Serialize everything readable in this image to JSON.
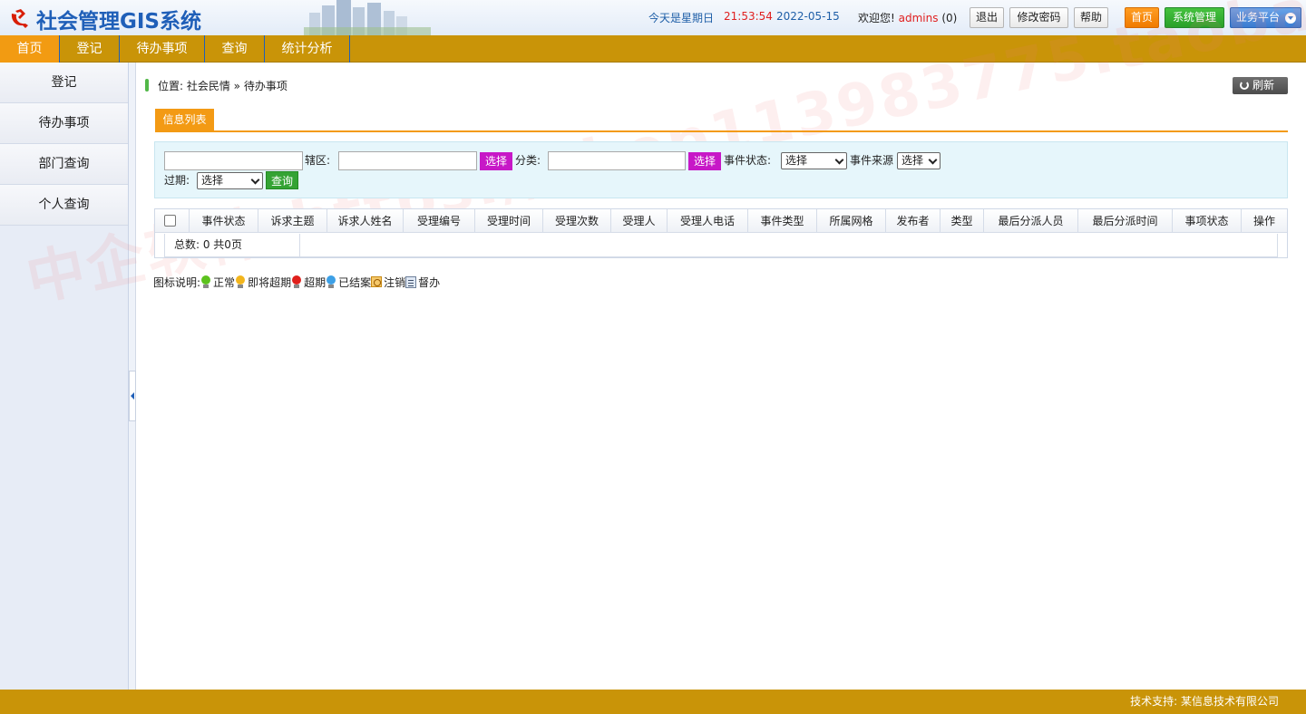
{
  "header": {
    "app_title": "社会管理GIS系统",
    "day_text": "今天是星期日",
    "time": "21:53:54",
    "date": "2022-05-15",
    "welcome_label": "欢迎您!",
    "username": "admins",
    "message_count": "(0)",
    "logout_label": "退出",
    "change_password_label": "修改密码",
    "help_label": "帮助",
    "home_label": "首页",
    "system_admin_label": "系统管理",
    "business_platform_label": "业务平台"
  },
  "nav": {
    "items": [
      {
        "label": "首页",
        "active": true
      },
      {
        "label": "登记",
        "active": false
      },
      {
        "label": "待办事项",
        "active": false
      },
      {
        "label": "查询",
        "active": false
      },
      {
        "label": "统计分析",
        "active": false
      }
    ]
  },
  "sidebar": {
    "items": [
      {
        "label": "登记"
      },
      {
        "label": "待办事项"
      },
      {
        "label": "部门查询"
      },
      {
        "label": "个人查询"
      }
    ]
  },
  "breadcrumb": {
    "text": "位置: 社会民情 » 待办事项"
  },
  "toolbar": {
    "refresh_label": "刷新"
  },
  "tab": {
    "label": "信息列表"
  },
  "filter": {
    "keyword_value": "",
    "district_label": "辖区:",
    "district_value": "",
    "district_select_label": "选择",
    "category_label": "分类:",
    "category_value": "",
    "category_select_label": "选择",
    "event_status_label": "事件状态:",
    "event_status_value": "选择",
    "event_source_label": "事件来源",
    "event_source_value": "选择",
    "overdue_label": "过期:",
    "overdue_value": "选择",
    "query_label": "查询"
  },
  "table": {
    "columns": [
      "事件状态",
      "诉求主题",
      "诉求人姓名",
      "受理编号",
      "受理时间",
      "受理次数",
      "受理人",
      "受理人电话",
      "事件类型",
      "所属网格",
      "发布者",
      "类型",
      "最后分派人员",
      "最后分派时间",
      "事项状态",
      "操作"
    ],
    "summary": "总数: 0  共0页"
  },
  "legend": {
    "title": "图标说明:",
    "items": [
      {
        "label": "正常",
        "icon": "bulb-green-icon",
        "color": "#5cc21e"
      },
      {
        "label": "即将超期",
        "icon": "bulb-yellow-icon",
        "color": "#f2b51d"
      },
      {
        "label": "超期",
        "icon": "bulb-red-icon",
        "color": "#e0201c"
      },
      {
        "label": "已结案",
        "icon": "bulb-blue-icon",
        "color": "#3da0e6"
      },
      {
        "label": "注销",
        "icon": "cancel-icon"
      },
      {
        "label": "督办",
        "icon": "supervise-icon"
      }
    ]
  },
  "watermark": "中企软件-https://shop113983775.taobao.com",
  "footer": {
    "text": "技术支持: 某信息技术有限公司"
  }
}
